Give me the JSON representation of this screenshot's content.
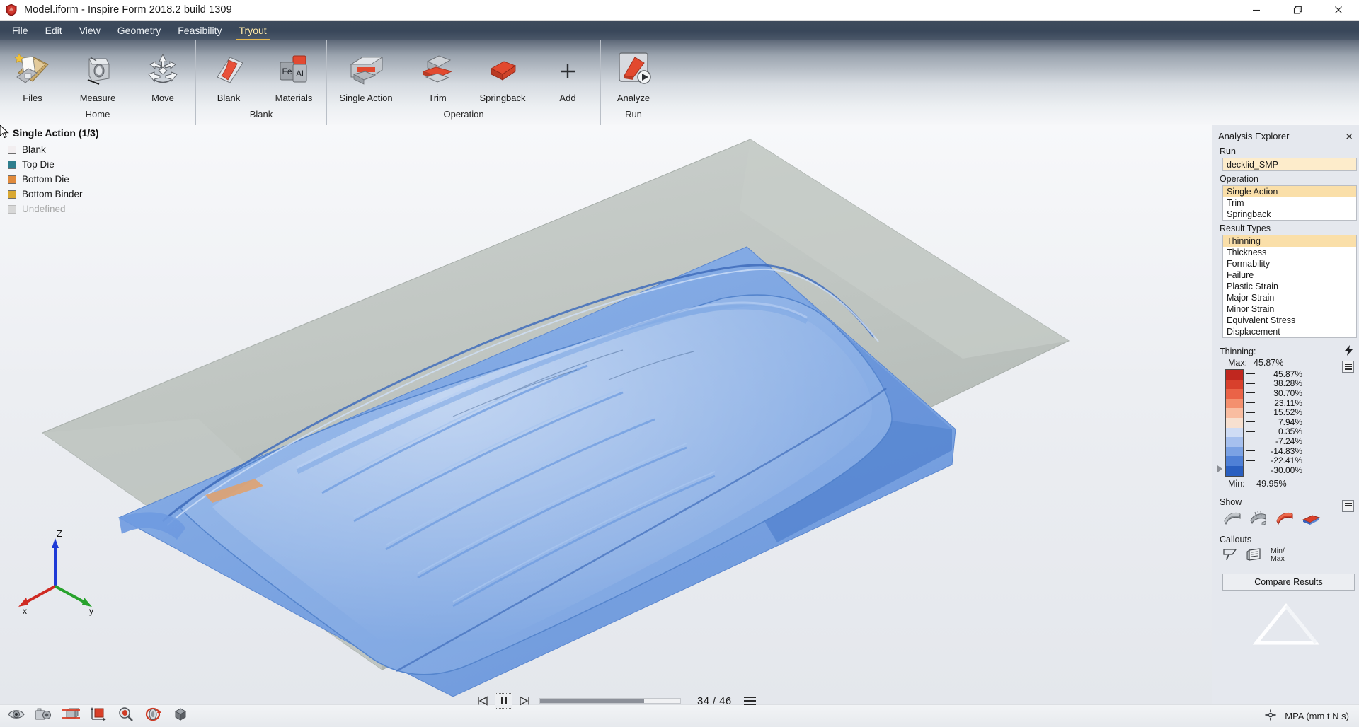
{
  "window": {
    "title": "Model.iform - Inspire Form 2018.2 build 1309",
    "app_icon": "inspire-form-logo-icon",
    "minimize_label": "—",
    "maximize_label": "❐",
    "close_label": "✕"
  },
  "menubar": {
    "items": [
      {
        "label": "File",
        "active": false
      },
      {
        "label": "Edit",
        "active": false
      },
      {
        "label": "View",
        "active": false
      },
      {
        "label": "Geometry",
        "active": false
      },
      {
        "label": "Feasibility",
        "active": false
      },
      {
        "label": "Tryout",
        "active": true
      }
    ]
  },
  "ribbon": {
    "groups": [
      {
        "name": "Home",
        "buttons": [
          {
            "label": "Files",
            "icon": "files-icon"
          },
          {
            "label": "Measure",
            "icon": "measure-icon"
          },
          {
            "label": "Move",
            "icon": "move-icon"
          }
        ]
      },
      {
        "name": "Blank",
        "buttons": [
          {
            "label": "Blank",
            "icon": "blank-sheet-icon"
          },
          {
            "label": "Materials",
            "icon": "materials-icon"
          }
        ]
      },
      {
        "name": "Operation",
        "buttons": [
          {
            "label": "Single Action",
            "icon": "single-action-icon"
          },
          {
            "label": "Trim",
            "icon": "trim-icon"
          },
          {
            "label": "Springback",
            "icon": "springback-icon"
          },
          {
            "label": "Add",
            "icon": "add-plus-icon"
          }
        ]
      },
      {
        "name": "Run",
        "buttons": [
          {
            "label": "Analyze",
            "icon": "analyze-run-icon"
          }
        ]
      }
    ]
  },
  "model_tree": {
    "title": "Single Action (1/3)",
    "items": [
      {
        "label": "Blank",
        "color": "#f2eef0",
        "disabled": false
      },
      {
        "label": "Top Die",
        "color": "#2e7e8e",
        "disabled": false
      },
      {
        "label": "Bottom Die",
        "color": "#e08a3c",
        "disabled": false
      },
      {
        "label": "Bottom Binder",
        "color": "#d9a832",
        "disabled": false
      },
      {
        "label": "Undefined",
        "color": "#d7d7d7",
        "disabled": true
      }
    ]
  },
  "playback": {
    "first_label": "⏮",
    "pause_label": "⏸",
    "last_label": "⏭",
    "progress_percent": 74,
    "frame_text": "34 / 46",
    "menu_icon": "hamburger-icon"
  },
  "statusbar": {
    "icons": [
      "view-eye-icon",
      "camera-icon",
      "section-cut-icon",
      "axis-box-icon",
      "zoom-icon",
      "rotate-icon",
      "iso-cube-icon"
    ],
    "units_icon": "origin-crosshair-icon",
    "units_text": "MPA (mm t N s)"
  },
  "right_panel": {
    "title": "Analysis Explorer",
    "close_label": "✕",
    "run": {
      "label": "Run",
      "value": "decklid_SMP"
    },
    "operation": {
      "label": "Operation",
      "items": [
        "Single Action",
        "Trim",
        "Springback"
      ],
      "selected": "Single Action"
    },
    "result_types": {
      "label": "Result Types",
      "items": [
        "Thinning",
        "Thickness",
        "Formability",
        "Failure",
        "Plastic Strain",
        "Major Strain",
        "Minor Strain",
        "Equivalent Stress",
        "Displacement"
      ],
      "selected": "Thinning"
    },
    "legend": {
      "title": "Thinning:",
      "bolt_icon": "lightning-bolt-icon",
      "menu_icon": "legend-menu-icon",
      "max_label": "Max:",
      "max_value": "45.87%",
      "min_label": "Min:",
      "min_value": "-49.95%",
      "ticks": [
        "45.87%",
        "38.28%",
        "30.70%",
        "23.11%",
        "15.52%",
        "7.94%",
        "0.35%",
        "-7.24%",
        "-14.83%",
        "-22.41%",
        "-30.00%"
      ],
      "band_colors": [
        "#c0271f",
        "#d8402c",
        "#ea6347",
        "#f4906e",
        "#f9bda1",
        "#f7e0d0",
        "#cfdcf4",
        "#a6c0ee",
        "#7ba2e4",
        "#4f80d6",
        "#2a5fc0"
      ]
    },
    "show": {
      "label": "Show",
      "icons": [
        "part-solid-icon",
        "part-mesh-icon",
        "part-max-icon",
        "part-range-icon"
      ],
      "menu_icon": "show-menu-icon"
    },
    "callouts": {
      "label": "Callouts",
      "icons": [
        "callout-pointer-icon",
        "callout-table-icon"
      ],
      "minmax_line1": "Min/",
      "minmax_line2": "Max"
    },
    "compare_button": "Compare Results",
    "logo_icon": "altair-triangle-logo-icon"
  },
  "viewport": {
    "triad": {
      "z_label": "Z",
      "x_label": "x",
      "y_label": "y"
    },
    "cursor_icon": "mouse-pointer-icon"
  },
  "chart_data": {
    "type": "heatmap",
    "title": "Thinning",
    "unit": "%",
    "min": -49.95,
    "max": 45.87,
    "levels": [
      45.87,
      38.28,
      30.7,
      23.11,
      15.52,
      7.94,
      0.35,
      -7.24,
      -14.83,
      -22.41,
      -30.0
    ],
    "colors": [
      "#c0271f",
      "#d8402c",
      "#ea6347",
      "#f4906e",
      "#f9bda1",
      "#f7e0d0",
      "#cfdcf4",
      "#a6c0ee",
      "#7ba2e4",
      "#4f80d6",
      "#2a5fc0"
    ],
    "legend_position": "right"
  }
}
